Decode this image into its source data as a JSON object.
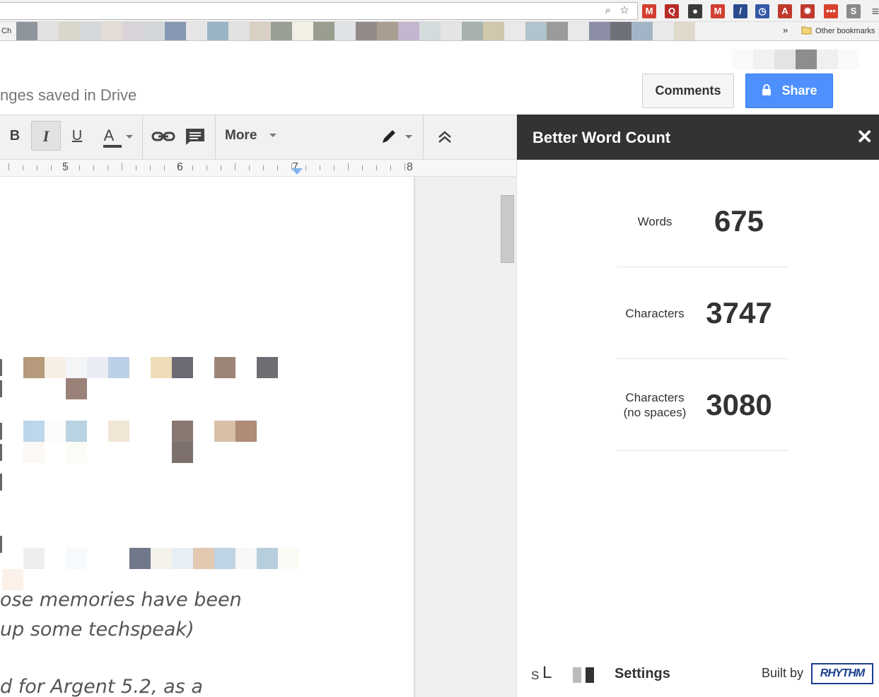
{
  "browser": {
    "bookmarks_bar": {
      "first_label": "Ch",
      "chevron": "»",
      "other_bookmarks": "Other bookmarks"
    },
    "omnibox_icons": [
      "zoom-icon",
      "star-icon"
    ],
    "extension_icons": [
      {
        "name": "gmail-icon",
        "glyph": "M",
        "color": "#d23f31"
      },
      {
        "name": "quora-icon",
        "glyph": "Q",
        "color": "#b92b27"
      },
      {
        "name": "evernote-icon",
        "glyph": "●",
        "color": "#3a3a3a"
      },
      {
        "name": "mail-checker-icon",
        "glyph": "M",
        "color": "#d23f31"
      },
      {
        "name": "pen-icon",
        "glyph": "/",
        "color": "#2a4b8d"
      },
      {
        "name": "timer-icon",
        "glyph": "◷",
        "color": "#3557a6"
      },
      {
        "name": "pdf-icon",
        "glyph": "A",
        "color": "#c0392b"
      },
      {
        "name": "bug-icon",
        "glyph": "✹",
        "color": "#c0392b"
      },
      {
        "name": "todo-icon",
        "glyph": "•••",
        "color": "#d9412f"
      },
      {
        "name": "s-extension-icon",
        "glyph": "S",
        "color": "#8a8a8a"
      },
      {
        "name": "menu-icon",
        "glyph": "≡",
        "color": "#555555"
      }
    ]
  },
  "docs": {
    "save_status": "nges saved in Drive",
    "comments_label": "Comments",
    "share_label": "Share",
    "toolbar": {
      "bold": "B",
      "italic": "I",
      "underline": "U",
      "text_color": "A",
      "more_label": "More",
      "collapse": "⌃"
    },
    "ruler_numbers": [
      "5",
      "6",
      "7",
      "8"
    ],
    "document_lines": [
      "ose memories have been",
      " up some techspeak)",
      "d for Argent 5.2, as a"
    ]
  },
  "sidebar": {
    "title": "Better Word Count",
    "close": "✕",
    "stats": [
      {
        "label": "Words",
        "value": "675"
      },
      {
        "label": "Characters",
        "value": "3747"
      },
      {
        "label": "Characters\n(no spaces)",
        "value": "3080"
      }
    ],
    "footer": {
      "size_small": "S",
      "size_large": "L",
      "settings_label": "Settings",
      "built_by": "Built by",
      "brand": "RHYTHM"
    }
  },
  "colors": {
    "sidebar_header": "#333333",
    "share_button": "#4d90fe",
    "page_background": "#ffffff"
  }
}
